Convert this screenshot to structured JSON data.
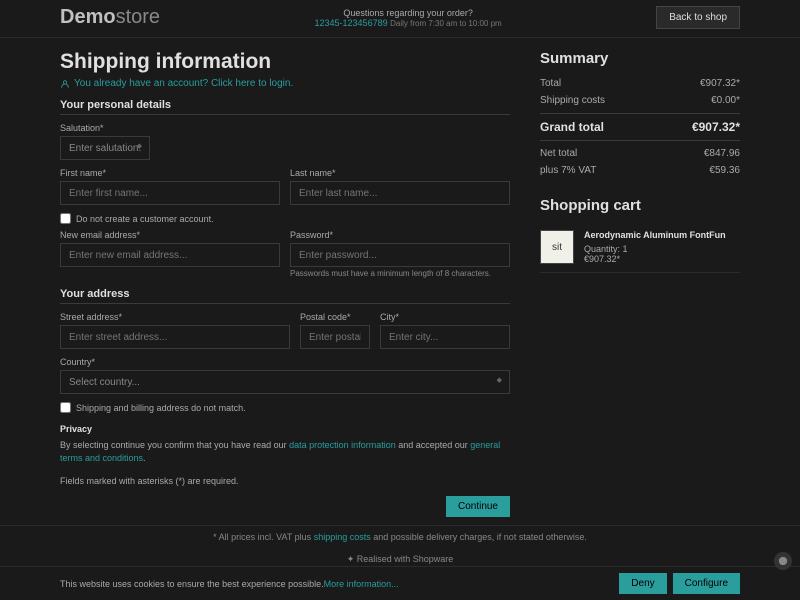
{
  "header": {
    "logo1": "Demo",
    "logo2": "store",
    "q": "Questions regarding your order?",
    "phone": "12345-123456789",
    "hours": "Daily from 7:30 am to 10:00 pm",
    "back": "Back to shop"
  },
  "title": "Shipping information",
  "login": "You already have an account? Click here to login.",
  "s1": "Your personal details",
  "sal": {
    "l": "Salutation*",
    "ph": "Enter salutation..."
  },
  "fn": {
    "l": "First name*",
    "ph": "Enter first name..."
  },
  "ln": {
    "l": "Last name*",
    "ph": "Enter last name..."
  },
  "noacct": "Do not create a customer account.",
  "em": {
    "l": "New email address*",
    "ph": "Enter new email address..."
  },
  "pw": {
    "l": "Password*",
    "ph": "Enter password...",
    "hint": "Passwords must have a minimum length of 8 characters."
  },
  "s2": "Your address",
  "st": {
    "l": "Street address*",
    "ph": "Enter street address..."
  },
  "pc": {
    "l": "Postal code*",
    "ph": "Enter postal code..."
  },
  "ct": {
    "l": "City*",
    "ph": "Enter city..."
  },
  "co": {
    "l": "Country*",
    "ph": "Select country..."
  },
  "diff": "Shipping and billing address do not match.",
  "priv": {
    "t": "Privacy",
    "pre": "By selecting continue you confirm that you have read our ",
    "l1": "data protection information",
    "mid": " and accepted our ",
    "l2": "general terms and conditions"
  },
  "req": "Fields marked with asterisks (*) are required.",
  "cont": "Continue",
  "sum": {
    "t": "Summary",
    "total": "Total",
    "totalV": "€907.32*",
    "ship": "Shipping costs",
    "shipV": "€0.00*",
    "gt": "Grand total",
    "gtV": "€907.32*",
    "net": "Net total",
    "netV": "€847.96",
    "vat": "plus 7% VAT",
    "vatV": "€59.36"
  },
  "cart": {
    "t": "Shopping cart",
    "img": "sit",
    "name": "Aerodynamic Aluminum FontFun",
    "qty": "Quantity: 1",
    "price": "€907.32*"
  },
  "ftr": {
    "pre": "* All prices incl. VAT plus ",
    "l": "shipping costs",
    "post": " and possible delivery charges, if not stated otherwise."
  },
  "ftr2": "Realised with Shopware",
  "cookie": {
    "txt": "This website uses cookies to ensure the best experience possible. ",
    "more": "More information...",
    "deny": "Deny",
    "conf": "Configure"
  }
}
